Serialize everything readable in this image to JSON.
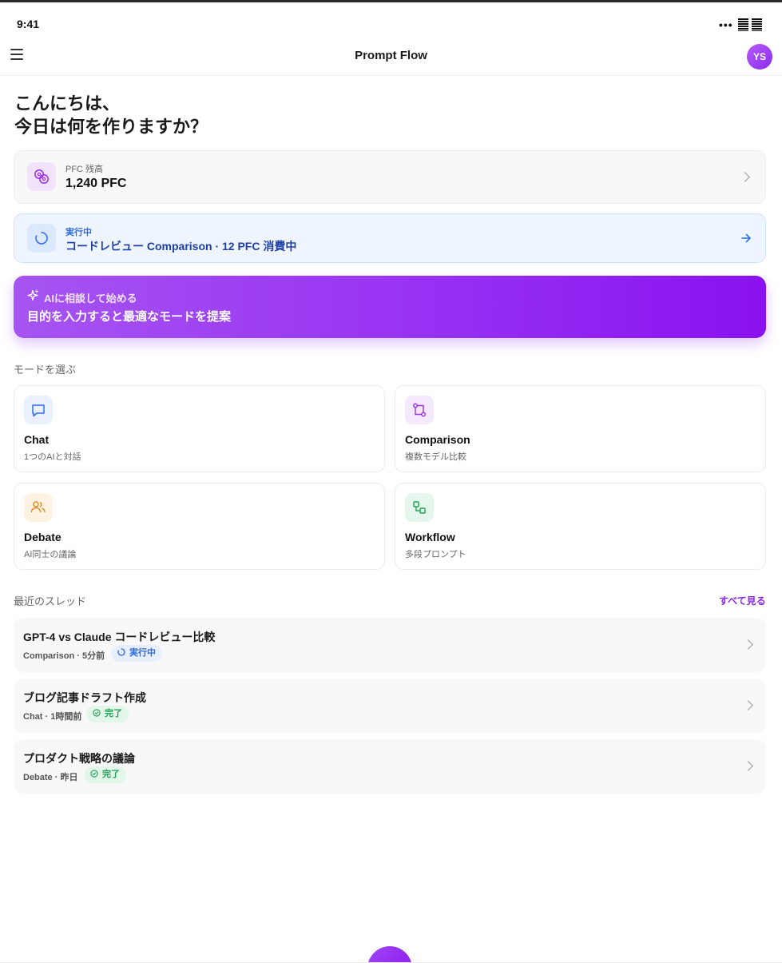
{
  "status_bar": {
    "time": "9:41",
    "dots": "•••"
  },
  "app_bar": {
    "title": "Prompt Flow",
    "avatar_initials": "YS"
  },
  "greeting": {
    "line1": "こんにちは、",
    "line2": "今日は何を作りますか？"
  },
  "balance": {
    "label": "PFC 残高",
    "value": "1,240 PFC",
    "icon": "coins-icon"
  },
  "running": {
    "label": "実行中",
    "text": "コードレビュー Comparison · 12 PFC 消費中",
    "icon": "spinner-icon"
  },
  "cta": {
    "label": "AIに相談して始める",
    "text": "目的を入力すると最適なモードを提案",
    "icon": "sparkles-icon"
  },
  "modes": {
    "section_title": "モードを選ぶ",
    "items": [
      {
        "name": "Chat",
        "desc": "1つのAIと対話",
        "icon": "chat-bubble-icon",
        "color": "#2f6fe8",
        "bg": "#eaf1fd"
      },
      {
        "name": "Comparison",
        "desc": "複数モデル比較",
        "icon": "git-compare-icon",
        "color": "#9b2ff0",
        "bg": "#f4e9fd"
      },
      {
        "name": "Debate",
        "desc": "AI同士の議論",
        "icon": "users-icon",
        "color": "#e08a1e",
        "bg": "#fef3e2"
      },
      {
        "name": "Workflow",
        "desc": "多段プロンプト",
        "icon": "workflow-icon",
        "color": "#1f9f53",
        "bg": "#e5f7ec"
      }
    ]
  },
  "threads": {
    "section_title": "最近のスレッド",
    "see_all": "すべて見る",
    "items": [
      {
        "title": "GPT-4 vs Claude コードレビュー比較",
        "meta": "Comparison · 5分前",
        "status": "実行中",
        "status_type": "running"
      },
      {
        "title": "ブログ記事ドラフト作成",
        "meta": "Chat · 1時間前",
        "status": "完了",
        "status_type": "done"
      },
      {
        "title": "プロダクト戦略の議論",
        "meta": "Debate · 昨日",
        "status": "完了",
        "status_type": "done"
      }
    ]
  },
  "colors": {
    "accent": "#8a24e8",
    "running": "#2a6be0",
    "done": "#1f9f53"
  }
}
